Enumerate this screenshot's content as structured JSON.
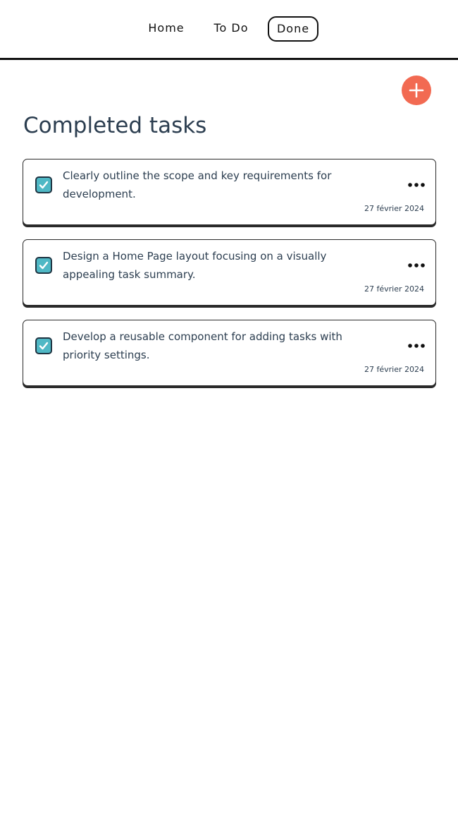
{
  "nav": {
    "items": [
      {
        "label": "Home"
      },
      {
        "label": "To Do"
      },
      {
        "label": "Done"
      }
    ],
    "active": "Done"
  },
  "add_button": {
    "icon": "plus-icon"
  },
  "page_title": "Completed tasks",
  "tasks": [
    {
      "text": "Clearly outline the scope and key requirements for development.",
      "date": "27 février 2024",
      "completed": true
    },
    {
      "text": "Design a Home Page layout focusing on a visually appealing task summary.",
      "date": "27 février 2024",
      "completed": true
    },
    {
      "text": "Develop a reusable component for adding tasks with priority settings.",
      "date": "27 février 2024",
      "completed": true
    }
  ],
  "colors": {
    "accent": "#f26a52",
    "checkbox": "#4fb8c5",
    "text": "#2c3e50",
    "border": "#111111"
  }
}
